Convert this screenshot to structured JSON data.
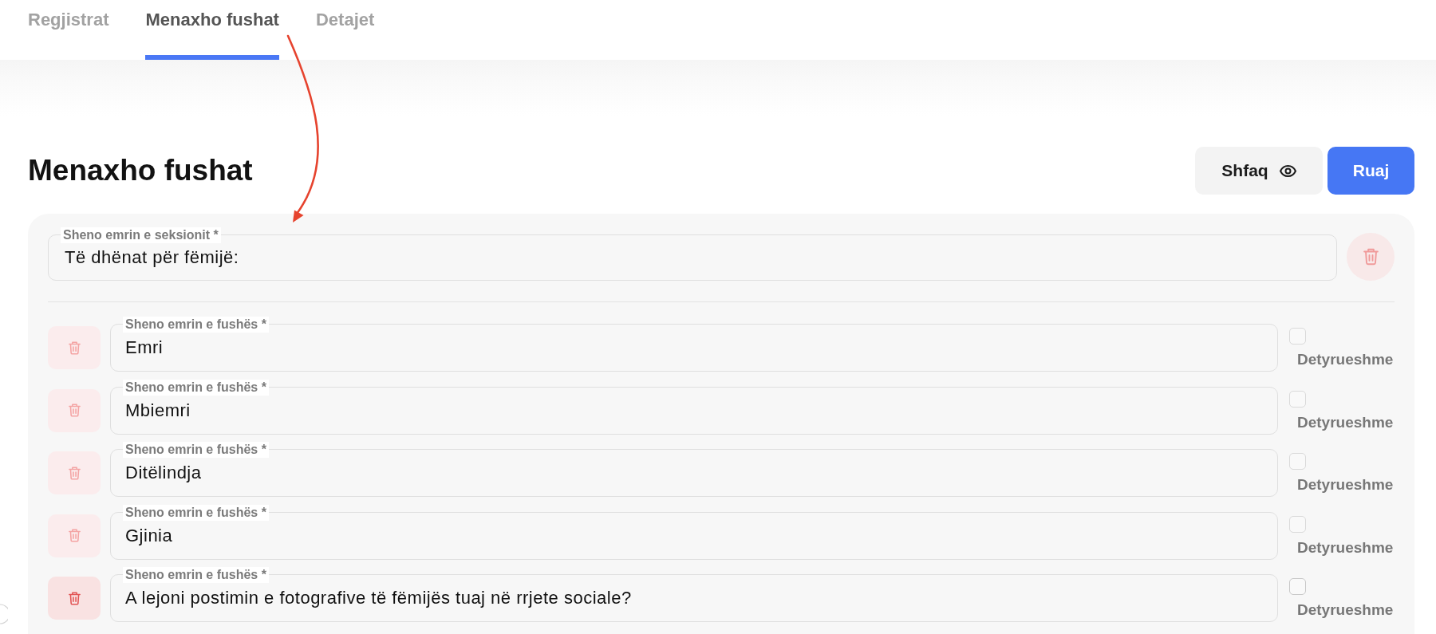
{
  "tabs": [
    {
      "label": "Regjistrat",
      "selected": false
    },
    {
      "label": "Menaxho fushat",
      "selected": true
    },
    {
      "label": "Detajet",
      "selected": false
    }
  ],
  "header": {
    "title": "Menaxho fushat",
    "buttons": [
      {
        "kind": "secondary",
        "label": "Shfaq"
      },
      {
        "kind": "primary",
        "label": "Ruaj"
      }
    ]
  },
  "section": {
    "name_field": {
      "label": "Sheno emrin e seksionit *",
      "value": "Të dhënat për fëmijë:"
    },
    "fields": [
      {
        "label": "Sheno emrin e fushës *",
        "value": "Emri",
        "required": false,
        "required_label": "Detyrueshme",
        "hovered": false
      },
      {
        "label": "Sheno emrin e fushës *",
        "value": "Mbiemri",
        "required": false,
        "required_label": "Detyrueshme",
        "hovered": false
      },
      {
        "label": "Sheno emrin e fushës *",
        "value": "Ditëlindja",
        "required": false,
        "required_label": "Detyrueshme",
        "hovered": false
      },
      {
        "label": "Sheno emrin e fushës *",
        "value": "Gjinia",
        "required": false,
        "required_label": "Detyrueshme",
        "hovered": false
      },
      {
        "label": "Sheno emrin e fushës *",
        "value": "A lejoni postimin e fotografive të fëmijës tuaj në rrjete sociale?",
        "required": false,
        "required_label": "Detyrueshme",
        "hovered": true
      }
    ]
  }
}
